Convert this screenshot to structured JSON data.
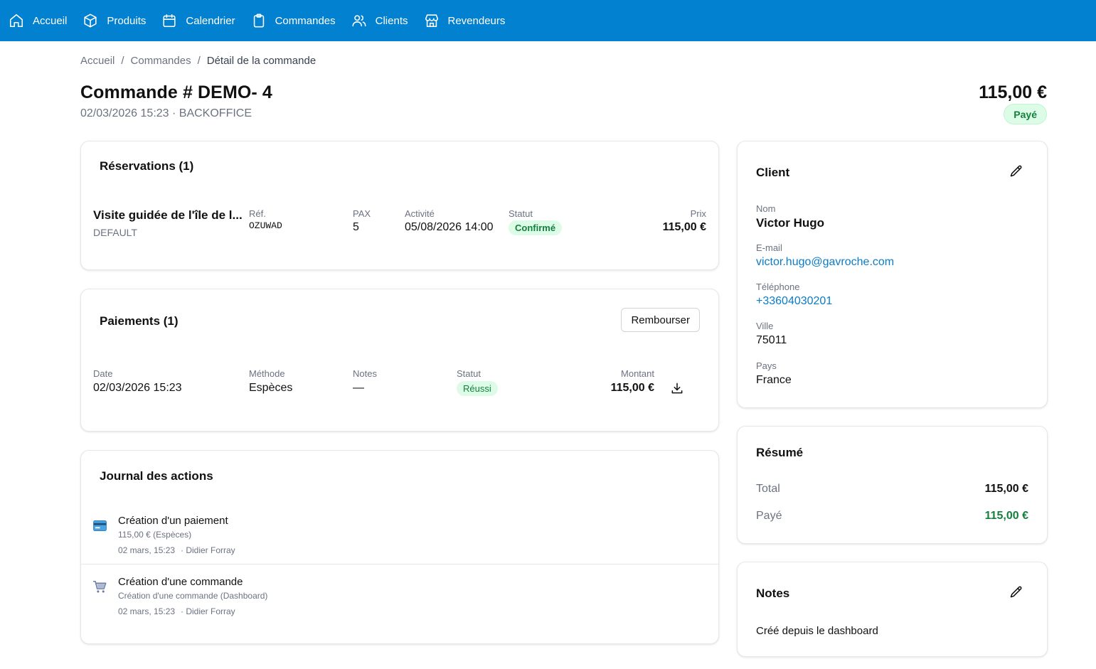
{
  "nav": {
    "items": [
      {
        "label": "Accueil",
        "icon": "home-icon"
      },
      {
        "label": "Produits",
        "icon": "box-icon"
      },
      {
        "label": "Calendrier",
        "icon": "calendar-icon"
      },
      {
        "label": "Commandes",
        "icon": "clipboard-icon"
      },
      {
        "label": "Clients",
        "icon": "users-icon"
      },
      {
        "label": "Revendeurs",
        "icon": "store-icon"
      }
    ],
    "background": "#0181cf"
  },
  "breadcrumb": {
    "items": [
      "Accueil",
      "Commandes"
    ],
    "current": "Détail de la commande",
    "separator": "/"
  },
  "header": {
    "title": "Commande # DEMO- 4",
    "subtitle": "02/03/2026 15:23 · BACKOFFICE",
    "total": "115,00 €",
    "status": "Payé"
  },
  "reservations": {
    "title": "Réservations (1)",
    "item": {
      "name": "Visite guidée de l'île de l...",
      "variant": "DEFAULT",
      "ref_label": "Réf.",
      "ref": "OZUWAD",
      "pax_label": "PAX",
      "pax": "5",
      "activity_label": "Activité",
      "activity": "05/08/2026 14:00",
      "status_label": "Statut",
      "status": "Confirmé",
      "price_label": "Prix",
      "price": "115,00 €"
    }
  },
  "payments": {
    "title": "Paiements (1)",
    "refund_label": "Rembourser",
    "item": {
      "date_label": "Date",
      "date": "02/03/2026 15:23",
      "method_label": "Méthode",
      "method": "Espèces",
      "notes_label": "Notes",
      "notes": "—",
      "status_label": "Statut",
      "status": "Réussi",
      "amount_label": "Montant",
      "amount": "115,00 €"
    }
  },
  "journal": {
    "title": "Journal des actions",
    "entries": [
      {
        "icon": "credit-card-icon",
        "title": "Création d'un paiement",
        "detail": "115,00 € (Espèces)",
        "date": "02 mars, 15:23",
        "author": "· Didier Forray"
      },
      {
        "icon": "shopping-cart-icon",
        "title": "Création d'une commande",
        "detail": "Création d'une commande (Dashboard)",
        "date": "02 mars, 15:23",
        "author": "· Didier Forray"
      }
    ]
  },
  "client": {
    "title": "Client",
    "name_label": "Nom",
    "name": "Victor Hugo",
    "email_label": "E-mail",
    "email": "victor.hugo@gavroche.com",
    "phone_label": "Téléphone",
    "phone": "+33604030201",
    "city_label": "Ville",
    "city": "75011",
    "country_label": "Pays",
    "country": "France"
  },
  "summary": {
    "title": "Résumé",
    "total_label": "Total",
    "total": "115,00 €",
    "paid_label": "Payé",
    "paid": "115,00 €",
    "paid_color": "#15803d"
  },
  "notes": {
    "title": "Notes",
    "text": "Créé depuis le dashboard"
  }
}
